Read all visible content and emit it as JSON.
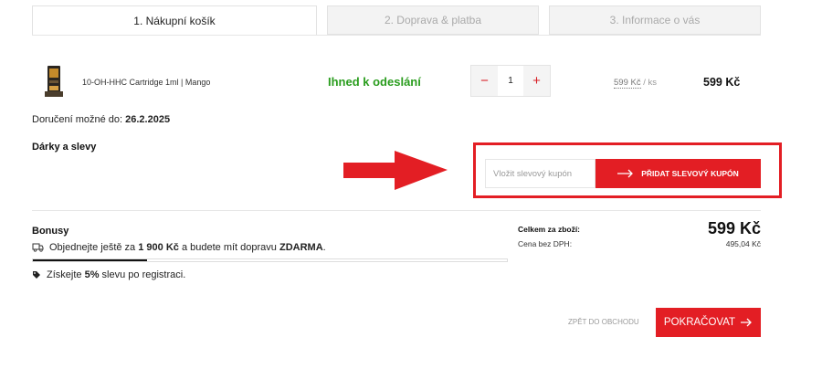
{
  "tabs": [
    {
      "label": "1. Nákupní košík"
    },
    {
      "label": "2. Doprava & platba"
    },
    {
      "label": "3. Informace o vás"
    }
  ],
  "product": {
    "name": "10-OH-HHC Cartridge 1ml | Mango",
    "stock": "Ihned k odeslání",
    "quantity": "1",
    "unit_price": "599 Kč",
    "unit_suffix": "/ ks",
    "total": "599 Kč"
  },
  "delivery": {
    "label": "Doručení možné do:",
    "date": "26.2.2025"
  },
  "gifts_title": "Dárky a slevy",
  "coupon": {
    "placeholder": "Vložit slevový kupón",
    "button_label": "PŘIDAT SLEVOVÝ KUPÓN"
  },
  "bonus": {
    "title": "Bonusy",
    "ship_pre": "Objednejte ještě za",
    "ship_amount": "1 900 Kč",
    "ship_mid": "a budete mít dopravu",
    "ship_free": "ZDARMA",
    "ship_end": ".",
    "progress_fraction": 0.24,
    "reg_pre": "Získejte",
    "reg_pct": "5%",
    "reg_post": "slevu po registraci."
  },
  "totals": {
    "label": "Celkem za zboží:",
    "value": "599 Kč",
    "vat_label": "Cena bez DPH:",
    "vat_value": "495,04 Kč"
  },
  "actions": {
    "back": "ZPĚT DO OBCHODU",
    "continue": "POKRAČOVAT"
  },
  "colors": {
    "accent": "#e31e24",
    "stock": "#2a9d1e"
  }
}
